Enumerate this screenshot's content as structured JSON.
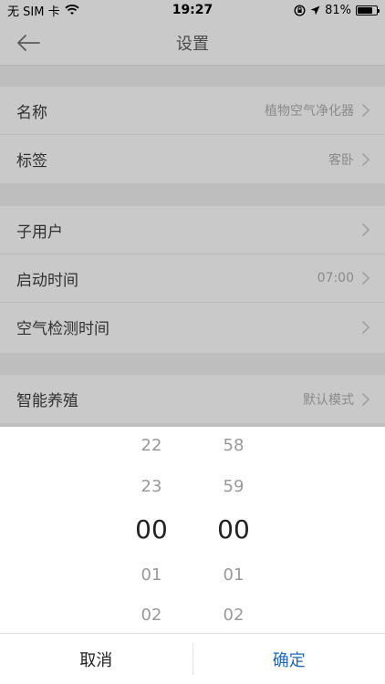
{
  "status_bar": {
    "carrier": "无 SIM 卡",
    "time": "19:27",
    "battery": "81%",
    "battery_level": 0.81
  },
  "nav": {
    "title": "设置"
  },
  "settings": {
    "name": {
      "label": "名称",
      "value": "植物空气净化器"
    },
    "tag": {
      "label": "标签",
      "value": "客卧"
    },
    "sub_user": {
      "label": "子用户"
    },
    "start_time": {
      "label": "启动时间",
      "value": "07:00"
    },
    "air_check": {
      "label": "空气检测时间"
    },
    "smart_breeding": {
      "label": "智能养殖",
      "value": "默认模式"
    }
  },
  "picker": {
    "hours": [
      "22",
      "23",
      "00",
      "01",
      "02"
    ],
    "minutes": [
      "58",
      "59",
      "00",
      "01",
      "02"
    ],
    "cancel_label": "取消",
    "confirm_label": "确定"
  },
  "colors": {
    "accent": "#1d68b8",
    "overlay_background": "#c9c9c9"
  },
  "icons": {
    "back": "arrow-left-icon",
    "chevron": "chevron-right-icon",
    "wifi": "wifi-icon",
    "lock_rotation": "rotation-lock-icon",
    "location": "location-arrow-icon",
    "battery": "battery-icon"
  }
}
